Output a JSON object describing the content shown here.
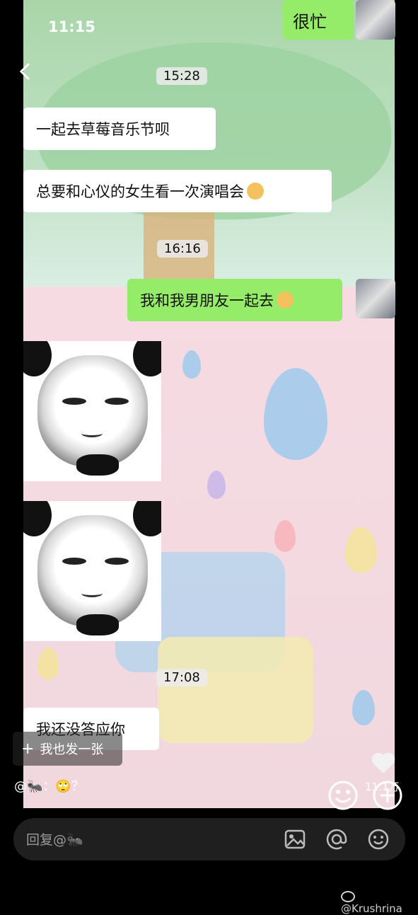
{
  "status_bar": {
    "time": "11:15"
  },
  "header": {
    "name_text": "很忙"
  },
  "chat": {
    "times": [
      "15:28",
      "16:16",
      "17:08"
    ],
    "messages": [
      {
        "from": "other",
        "text": "一起去草莓音乐节呗"
      },
      {
        "from": "other",
        "text": "总要和心仪的女生看一次演唱会"
      },
      {
        "from": "me",
        "text": "我和我男朋友一起去"
      },
      {
        "from": "other",
        "type": "sticker",
        "icon": "panda-meme-sticker"
      },
      {
        "from": "other",
        "type": "sticker",
        "icon": "panda-meme-sticker"
      },
      {
        "from": "other",
        "text": "我还没答应你"
      }
    ]
  },
  "post_overlay": {
    "also_post_label": "我也发一张",
    "comment_text": "@🐜：🙄？",
    "like_count": "11.1万"
  },
  "reply_bar": {
    "placeholder": "回复@🐜"
  },
  "watermark": "@Krushrina",
  "colors": {
    "my_bubble": "#95ec69",
    "other_bubble": "#ffffff",
    "background": "#000000"
  }
}
